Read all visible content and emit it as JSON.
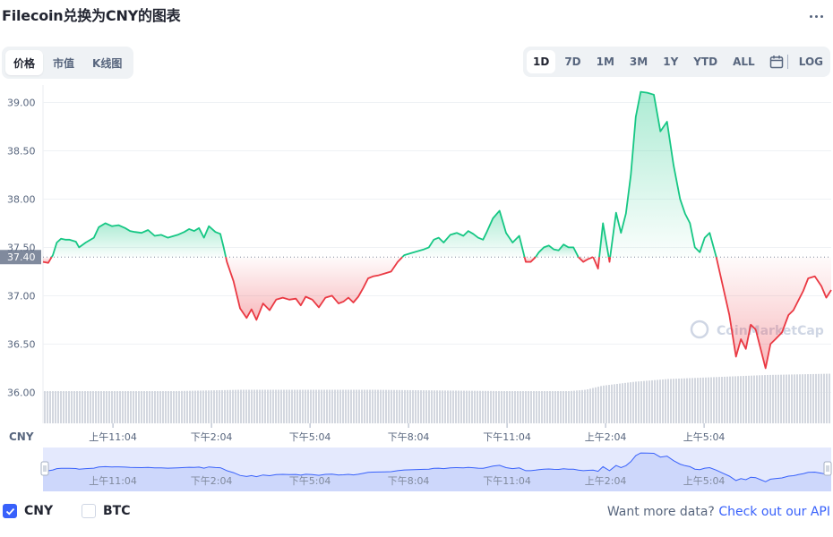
{
  "header": {
    "title": "Filecoin兑换为CNY的图表"
  },
  "tabs_left": [
    {
      "label": "价格",
      "active": true
    },
    {
      "label": "市值",
      "active": false
    },
    {
      "label": "K线图",
      "active": false
    }
  ],
  "tabs_right": [
    {
      "label": "1D",
      "active": true
    },
    {
      "label": "7D"
    },
    {
      "label": "1M"
    },
    {
      "label": "3M"
    },
    {
      "label": "1Y"
    },
    {
      "label": "YTD"
    },
    {
      "label": "ALL"
    }
  ],
  "log_label": "LOG",
  "legend": {
    "cny": "CNY",
    "btc": "BTC",
    "cny_checked": true,
    "btc_checked": false
  },
  "footer": {
    "prompt": "Want more data?",
    "link": "Check out our API"
  },
  "colors": {
    "up": "#16c784",
    "down": "#ea3943",
    "volume": "#d3d7df",
    "navigator_line": "#3861fb",
    "navigator_fill": "#e4e9fd",
    "accent": "#3861fb"
  },
  "chart_data": {
    "type": "line",
    "currency_label": "CNY",
    "baseline": 37.4,
    "baseline_label": "37.40",
    "y_ticks": [
      "39.00",
      "38.50",
      "38.00",
      "37.50",
      "37.00",
      "36.50",
      "36.00"
    ],
    "ylim": [
      35.68,
      39.18
    ],
    "x_ticks": [
      "上午11:04",
      "下午2:04",
      "下午5:04",
      "下午8:04",
      "下午11:04",
      "上午2:04",
      "上午5:04"
    ],
    "x_range_hours": [
      0,
      24
    ],
    "x_tick_hours": [
      2.13,
      5.13,
      8.13,
      11.13,
      14.13,
      17.13,
      20.13
    ],
    "watermark": "CoinMarketCap",
    "series": [
      {
        "x": [
          0,
          0.16,
          0.3,
          0.42,
          0.55,
          0.68,
          0.8,
          1.0,
          1.1,
          1.3,
          1.55,
          1.7,
          1.9,
          2.1,
          2.3,
          2.5,
          2.65,
          2.8,
          3.0,
          3.2,
          3.4,
          3.6,
          3.8,
          4.1,
          4.3,
          4.45,
          4.6,
          4.75,
          4.9,
          5.05,
          5.25,
          5.4,
          5.5,
          5.6,
          5.8,
          6.0,
          6.2,
          6.35,
          6.5,
          6.7,
          6.9,
          7.1,
          7.3,
          7.5,
          7.7,
          7.85,
          8.0,
          8.2,
          8.4,
          8.6,
          8.8,
          9.0,
          9.15,
          9.3,
          9.45,
          9.6,
          9.75,
          9.9,
          10.05,
          10.2,
          10.4,
          10.6,
          10.8,
          11.0,
          11.2,
          11.4,
          11.6,
          11.75,
          11.9,
          12.05,
          12.2,
          12.4,
          12.6,
          12.8,
          12.95,
          13.1,
          13.25,
          13.4,
          13.5,
          13.7,
          13.9,
          14.1,
          14.3,
          14.5,
          14.7,
          14.85,
          15.0,
          15.1,
          15.25,
          15.4,
          15.55,
          15.7,
          15.85,
          16.0,
          16.15,
          16.3,
          16.45,
          16.6,
          16.75,
          16.9,
          17.05,
          17.25,
          17.45,
          17.6,
          17.75,
          17.9,
          18.05,
          18.2,
          18.4,
          18.6,
          18.8,
          19.0,
          19.2,
          19.4,
          19.55,
          19.7,
          19.85,
          20.0,
          20.15,
          20.3,
          20.5,
          20.7,
          20.9,
          21.1,
          21.25,
          21.4,
          21.55,
          21.7,
          21.85,
          22.0,
          22.15,
          22.3,
          22.5,
          22.7,
          22.85,
          23.0,
          23.15,
          23.3,
          23.5,
          23.7,
          23.85,
          24.0
        ],
        "y": [
          37.35,
          37.34,
          37.42,
          37.55,
          37.59,
          37.58,
          37.58,
          37.56,
          37.5,
          37.55,
          37.6,
          37.71,
          37.75,
          37.72,
          37.73,
          37.7,
          37.67,
          37.66,
          37.65,
          37.68,
          37.62,
          37.63,
          37.6,
          37.63,
          37.66,
          37.69,
          37.67,
          37.7,
          37.6,
          37.72,
          37.66,
          37.64,
          37.5,
          37.35,
          37.15,
          36.87,
          36.77,
          36.86,
          36.75,
          36.92,
          36.85,
          36.96,
          36.98,
          36.96,
          36.97,
          36.9,
          36.99,
          36.96,
          36.88,
          36.98,
          37.0,
          36.92,
          36.94,
          36.98,
          36.93,
          36.99,
          37.08,
          37.18,
          37.2,
          37.21,
          37.23,
          37.25,
          37.35,
          37.42,
          37.44,
          37.46,
          37.48,
          37.5,
          37.58,
          37.6,
          37.55,
          37.63,
          37.65,
          37.62,
          37.67,
          37.64,
          37.6,
          37.58,
          37.65,
          37.8,
          37.88,
          37.65,
          37.55,
          37.62,
          37.35,
          37.35,
          37.4,
          37.45,
          37.5,
          37.52,
          37.48,
          37.47,
          37.53,
          37.5,
          37.5,
          37.4,
          37.35,
          37.38,
          37.4,
          37.28,
          37.75,
          37.35,
          37.86,
          37.65,
          37.85,
          38.25,
          38.85,
          39.11,
          39.1,
          39.08,
          38.7,
          38.8,
          38.35,
          38.0,
          37.85,
          37.75,
          37.5,
          37.45,
          37.6,
          37.65,
          37.4,
          37.1,
          36.8,
          36.37,
          36.55,
          36.45,
          36.7,
          36.65,
          36.45,
          36.25,
          36.5,
          36.55,
          36.62,
          36.8,
          36.85,
          36.95,
          37.05,
          37.18,
          37.2,
          37.1,
          36.98,
          37.06
        ]
      }
    ],
    "volume": {
      "x": [
        0,
        2,
        4,
        6,
        8,
        10,
        12,
        14,
        16,
        16.5,
        17,
        18,
        19,
        20,
        21,
        22,
        23,
        24
      ],
      "values": [
        0.24,
        0.24,
        0.24,
        0.25,
        0.25,
        0.25,
        0.245,
        0.24,
        0.24,
        0.25,
        0.28,
        0.31,
        0.33,
        0.34,
        0.35,
        0.36,
        0.365,
        0.37
      ]
    },
    "navigator": {
      "x_ticks": [
        "上午11:04",
        "下午2:04",
        "下午5:04",
        "下午8:04",
        "下午11:04",
        "上午2:04",
        "上午5:04"
      ]
    }
  }
}
